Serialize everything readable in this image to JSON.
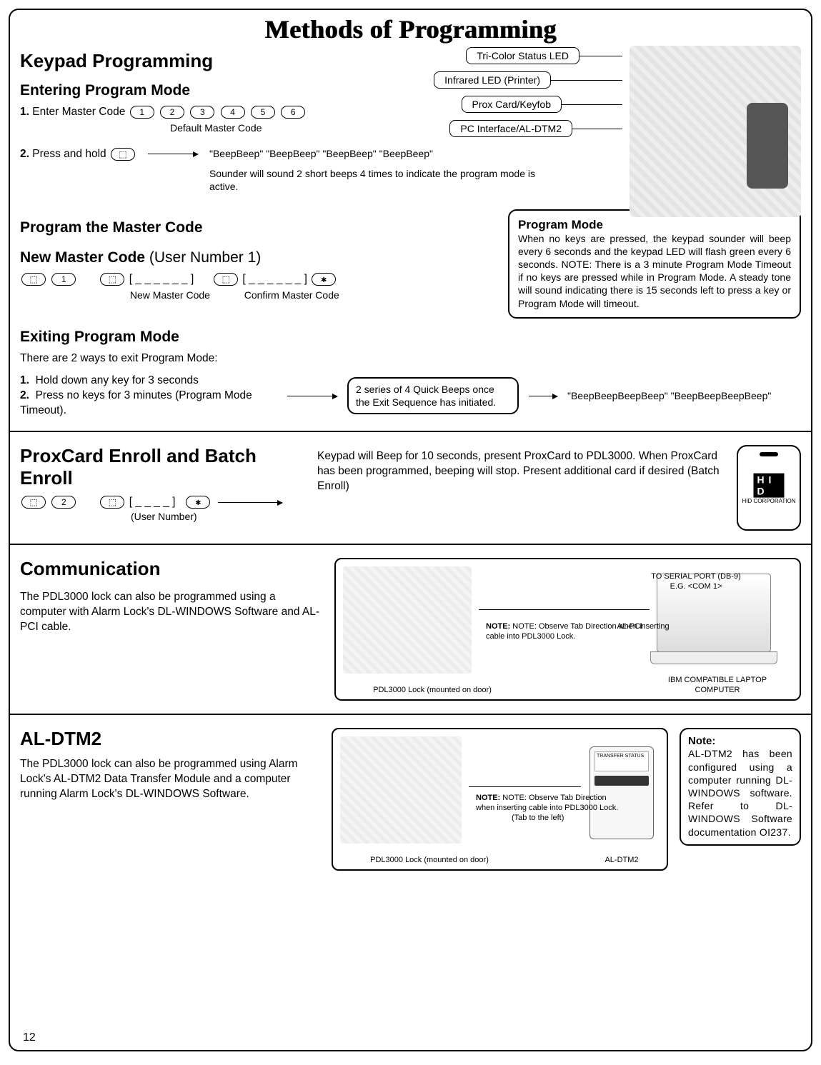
{
  "title": "Methods of Programming",
  "page_number": "12",
  "section1": {
    "heading": "Keypad Programming",
    "sub1": "Entering Program Mode",
    "step1_label": "1.",
    "step1_text": "Enter Master Code",
    "default_code_keys": [
      "1",
      "2",
      "3",
      "4",
      "5",
      "6"
    ],
    "default_code_caption": "Default Master Code",
    "step2_label": "2.",
    "step2_text": "Press and hold",
    "beep_line": "\"BeepBeep\"    \"BeepBeep\"      \"BeepBeep\"    \"BeepBeep\"",
    "beep_note": "Sounder will sound 2 short beeps 4 times to indicate the program mode is active.",
    "callouts": {
      "c1": "Tri-Color Status LED",
      "c2": "Infrared LED (Printer)",
      "c3": "Prox Card/Keyfob",
      "c4": "PC Interface/AL-DTM2"
    },
    "sub2": "Program the Master Code",
    "sub3_a": "New Master Code",
    "sub3_b": "(User Number 1)",
    "new_code_seq": "[ _ _ _ _ _ _ ]",
    "new_code_cap": "New Master Code",
    "confirm_code_cap": "Confirm Master Code",
    "program_mode_box_title": "Program Mode",
    "program_mode_box_body": "When no keys are pressed, the keypad sounder will beep every 6 seconds and the keypad LED will flash green every 6 seconds.   NOTE:  There is a 3 minute Program Mode Timeout if no keys are pressed while in Program Mode.  A steady tone will sound indicating there is 15 seconds left to press a key or Program Mode will timeout.",
    "sub4": "Exiting Program Mode",
    "exit_intro": "There are 2 ways to exit Program Mode:",
    "exit1_label": "1.",
    "exit1_text": "Hold down any key for 3 seconds",
    "exit2_label": "2.",
    "exit2_text": "Press no keys for 3 minutes (Program Mode Timeout).",
    "exit_box": "2 series of 4 Quick Beeps once the Exit Sequence has initiated.",
    "exit_beeps": "\"BeepBeepBeepBeep\"       \"BeepBeepBeepBeep\""
  },
  "section2": {
    "heading": "ProxCard Enroll and Batch Enroll",
    "seq_code": "[ _ _ _ _ ]",
    "seq_caption": "(User Number)",
    "body": "Keypad will Beep for 10 seconds, present ProxCard to PDL3000.  When ProxCard has been programmed, beeping will stop.  Present additional card if desired (Batch Enroll)",
    "hid_logo": "H I D",
    "hid_corp": "HID CORPORATION"
  },
  "section3": {
    "heading": "Communication",
    "body": "The PDL3000 lock can also be programmed using a computer with Alarm Lock's DL-WINDOWS Software and AL-PCI cable.",
    "diag": {
      "lock_caption": "PDL3000 Lock (mounted on door)",
      "serial": "TO SERIAL PORT (DB-9) E.G. <COM 1>",
      "alpci": "AL-PCI",
      "note": "NOTE: Observe Tab Direction when inserting cable into PDL3000  Lock.",
      "laptop": "IBM COMPATIBLE LAPTOP COMPUTER"
    }
  },
  "section4": {
    "heading": "AL-DTM2",
    "body": "The PDL3000 lock can also be programmed using Alarm Lock's AL-DTM2 Data Transfer Module and a computer running Alarm Lock's DL-WINDOWS Software.",
    "diag": {
      "lock_caption": "PDL3000 Lock (mounted on door)",
      "note": "NOTE: Observe Tab Direction when inserting cable into PDL3000  Lock.",
      "tab": "(Tab to the left)",
      "aldtm": "AL-DTM2"
    },
    "note_title": "Note:",
    "note_body": "AL-DTM2 has been configured using a computer running DL-WINDOWS software.  Refer to DL-WINDOWS Software documentation OI237."
  }
}
